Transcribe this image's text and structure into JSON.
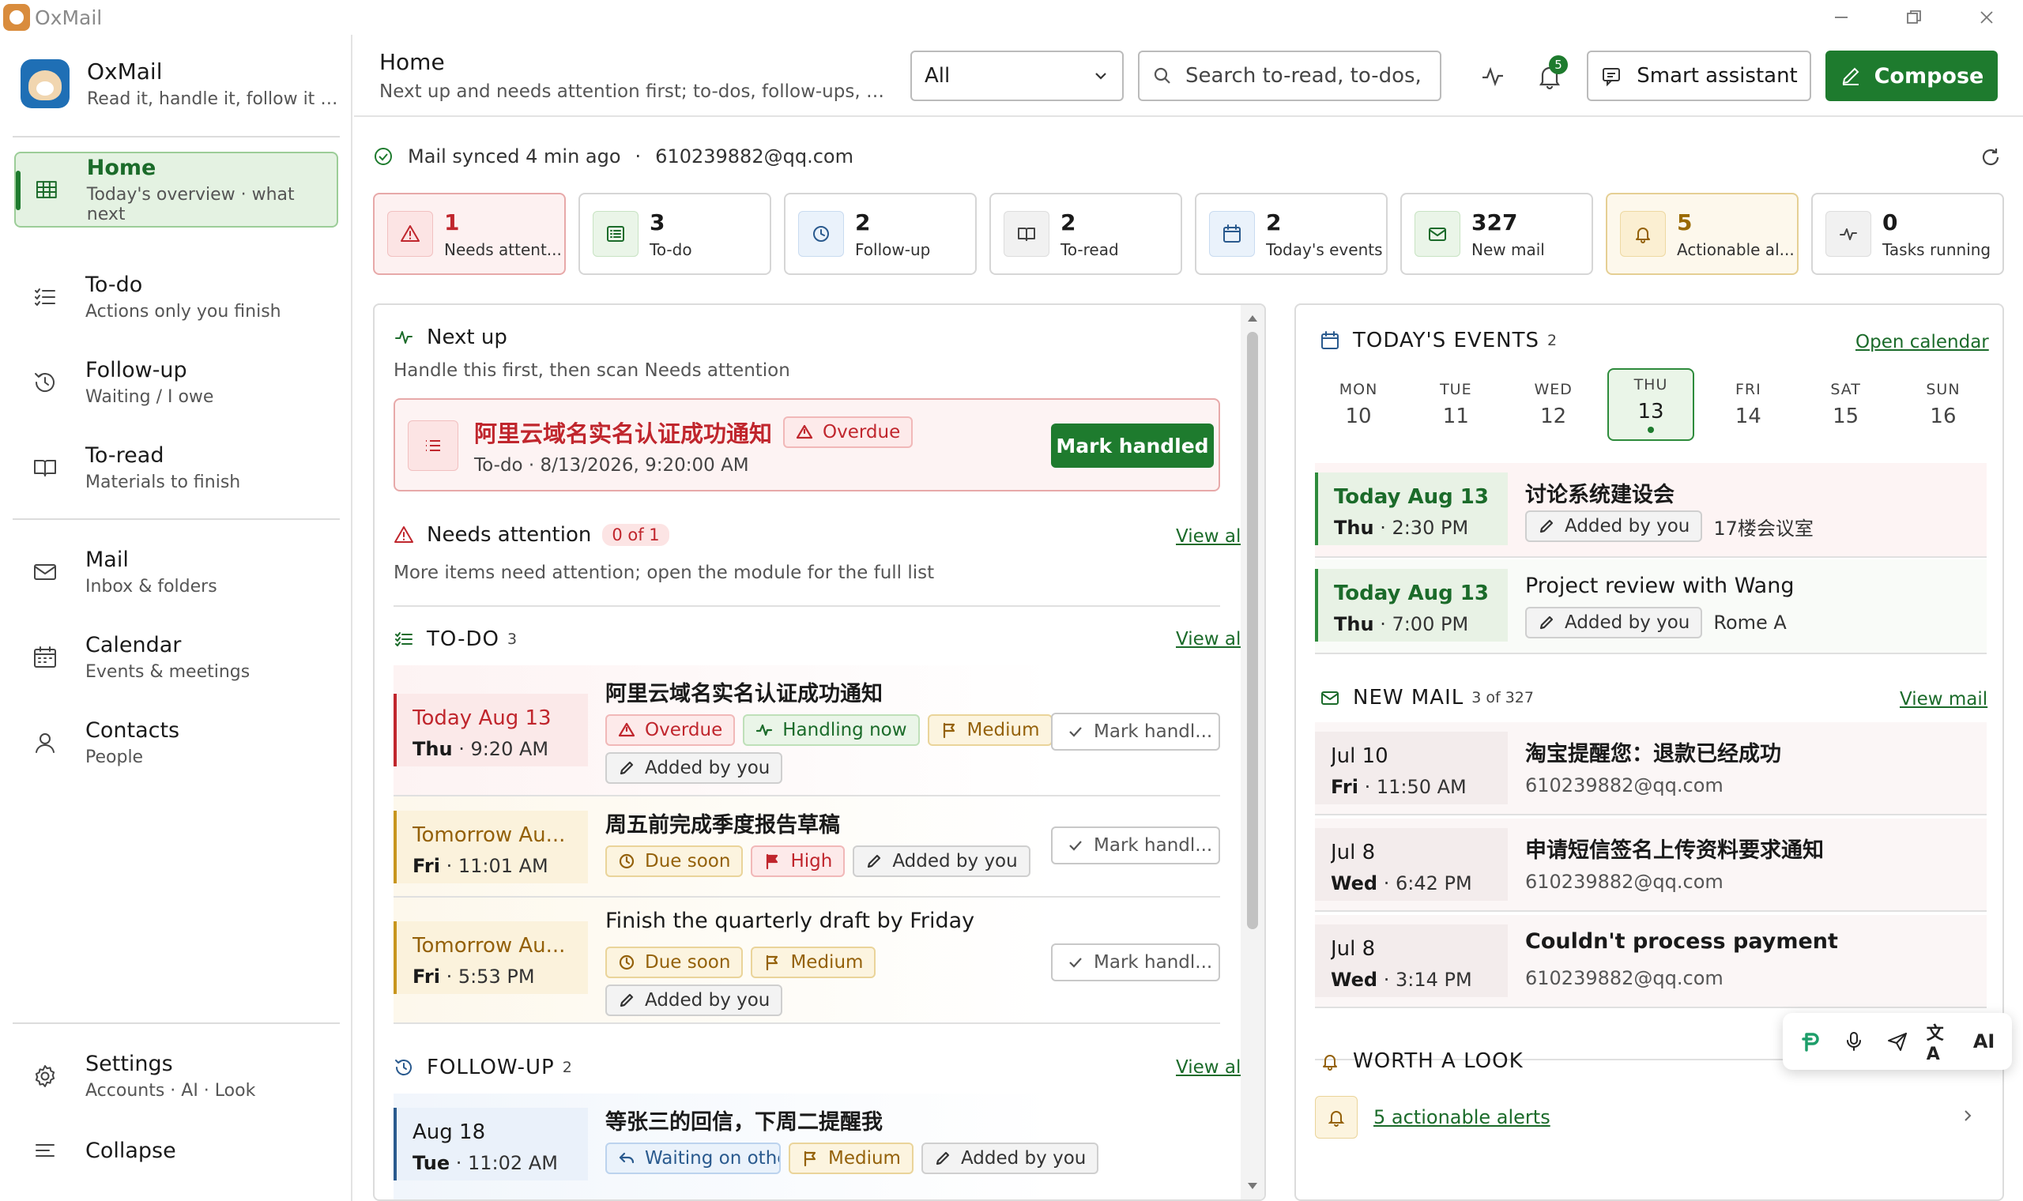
{
  "window": {
    "title": "OxMail"
  },
  "brand": {
    "name": "OxMail",
    "tagline": "Read it, handle it, follow it t..."
  },
  "sidebar": {
    "items": [
      {
        "title": "Home",
        "sub": "Today's overview · what next"
      },
      {
        "title": "To-do",
        "sub": "Actions only you finish"
      },
      {
        "title": "Follow-up",
        "sub": "Waiting / I owe"
      },
      {
        "title": "To-read",
        "sub": "Materials to finish"
      },
      {
        "title": "Mail",
        "sub": "Inbox & folders"
      },
      {
        "title": "Calendar",
        "sub": "Events & meetings"
      },
      {
        "title": "Contacts",
        "sub": "People"
      },
      {
        "title": "Settings",
        "sub": "Accounts · AI · Look"
      },
      {
        "title": "Collapse",
        "sub": ""
      }
    ]
  },
  "header": {
    "title": "Home",
    "subtitle": "Next up and needs attention first; to-dos, follow-ups, to-re...",
    "filter_value": "All",
    "search_placeholder": "Search to-read, to-dos,",
    "notif_count": "5",
    "assistant_label": "Smart assistant",
    "compose_label": "Compose"
  },
  "sync": {
    "status": "Mail synced 4 min ago",
    "dot": "·",
    "account": "610239882@qq.com"
  },
  "stats": [
    {
      "num": "1",
      "label": "Needs attent..."
    },
    {
      "num": "3",
      "label": "To-do"
    },
    {
      "num": "2",
      "label": "Follow-up"
    },
    {
      "num": "2",
      "label": "To-read"
    },
    {
      "num": "2",
      "label": "Today's events"
    },
    {
      "num": "327",
      "label": "New mail"
    },
    {
      "num": "5",
      "label": "Actionable al..."
    },
    {
      "num": "0",
      "label": "Tasks running"
    }
  ],
  "next_up": {
    "title": "Next up",
    "subtitle": "Handle this first, then scan Needs attention",
    "item_title": "阿里云域名实名认证成功通知",
    "item_tag": "Overdue",
    "item_meta": "To-do · 8/13/2026, 9:20:00 AM",
    "action": "Mark handled"
  },
  "needs_attention": {
    "title": "Needs attention",
    "count": "0 of 1",
    "view_all": "View all",
    "subtitle": "More items need attention; open the module for the full list"
  },
  "todo": {
    "title": "TO-DO",
    "count": "3",
    "view_all": "View all",
    "items": [
      {
        "d1": "Today Aug 13",
        "d2a": "Thu",
        "d2b": "· 9:20 AM",
        "title": "阿里云域名实名认证成功通知",
        "tags": [
          "Overdue",
          "Handling now",
          "Medium",
          "Added by you"
        ],
        "action": "Mark handl..."
      },
      {
        "d1": "Tomorrow Au...",
        "d2a": "Fri",
        "d2b": "· 11:01 AM",
        "title": "周五前完成季度报告草稿",
        "tags": [
          "Due soon",
          "High",
          "Added by you"
        ],
        "action": "Mark handl..."
      },
      {
        "d1": "Tomorrow Au...",
        "d2a": "Fri",
        "d2b": "· 5:53 PM",
        "title": "Finish the quarterly draft by Friday",
        "tags": [
          "Due soon",
          "Medium",
          "Added by you"
        ],
        "action": "Mark handl..."
      }
    ]
  },
  "followup": {
    "title": "FOLLOW-UP",
    "count": "2",
    "view_all": "View all",
    "items": [
      {
        "d1": "Aug 18",
        "d2a": "Tue",
        "d2b": "· 11:02 AM",
        "title": "等张三的回信，下周二提醒我",
        "tags": [
          "Waiting on othe",
          "Medium",
          "Added by you"
        ]
      }
    ]
  },
  "events": {
    "title": "TODAY'S EVENTS",
    "count": "2",
    "open": "Open calendar",
    "week": [
      {
        "dn": "MON",
        "dd": "10"
      },
      {
        "dn": "TUE",
        "dd": "11"
      },
      {
        "dn": "WED",
        "dd": "12"
      },
      {
        "dn": "THU",
        "dd": "13"
      },
      {
        "dn": "FRI",
        "dd": "14"
      },
      {
        "dn": "SAT",
        "dd": "15"
      },
      {
        "dn": "SUN",
        "dd": "16"
      }
    ],
    "items": [
      {
        "d1": "Today Aug 13",
        "d2a": "Thu",
        "d2b": "· 2:30 PM",
        "title": "讨论系统建设会",
        "tag": "Added by you",
        "location": "17楼会议室"
      },
      {
        "d1": "Today Aug 13",
        "d2a": "Thu",
        "d2b": "· 7:00 PM",
        "title": "Project review with Wang",
        "tag": "Added by you",
        "location": "Rome A"
      }
    ]
  },
  "new_mail": {
    "title": "NEW MAIL",
    "count": "3 of 327",
    "view": "View mail",
    "items": [
      {
        "d1": "Jul 10",
        "d2a": "Fri",
        "d2b": "· 11:50 AM",
        "title": "淘宝提醒您：退款已经成功",
        "from": "610239882@qq.com"
      },
      {
        "d1": "Jul 8",
        "d2a": "Wed",
        "d2b": "· 6:42 PM",
        "title": "申请短信签名上传资料要求通知",
        "from": "610239882@qq.com"
      },
      {
        "d1": "Jul 8",
        "d2a": "Wed",
        "d2b": "· 3:14 PM",
        "title": "Couldn't process payment",
        "from": "610239882@qq.com"
      }
    ]
  },
  "worth": {
    "title": "WORTH A LOOK",
    "link": "5 actionable alerts"
  },
  "float_toolbar": {
    "translate": "文A",
    "ai": "AI"
  }
}
